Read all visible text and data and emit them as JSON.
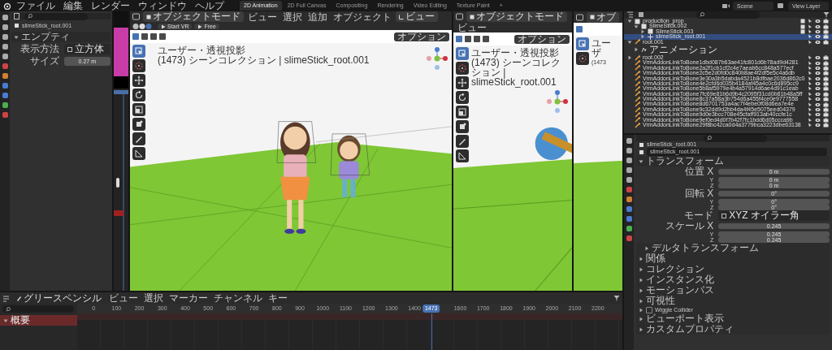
{
  "menu": [
    "ファイル",
    "編集",
    "レンダー",
    "ウィンドウ",
    "ヘルプ"
  ],
  "workspaces": [
    {
      "label": "2D Animation",
      "selected": true
    },
    {
      "label": "2D Full Canvas",
      "selected": false
    },
    {
      "label": "Compositing",
      "selected": false
    },
    {
      "label": "Rendering",
      "selected": false
    },
    {
      "label": "Video Editing",
      "selected": false
    },
    {
      "label": "Texture Paint",
      "selected": false
    }
  ],
  "workspace_add": "+",
  "scene": "Scene",
  "view_layer": "View Layer",
  "left_properties": {
    "object_name": "slimeStick_root.001",
    "section": {
      "label": "エンプティ",
      "expanded": true
    },
    "fields": [
      {
        "label": "表示方法",
        "value": "立方体",
        "kind": "dropdown"
      },
      {
        "label": "サイズ",
        "value": "0.27 m",
        "kind": "number"
      }
    ]
  },
  "viewports": [
    {
      "mode": "オブジェクトモード",
      "menus": [
        "ビュー",
        "選択",
        "追加",
        "オブジェクト"
      ],
      "view_menu": "ビュー",
      "buttons": [
        "Start VR",
        "Free"
      ],
      "options": "オプション",
      "view_name": "ユーザー・透視投影",
      "info": "(1473) シーンコレクション | slimeStick_root.001",
      "tools": [
        {
          "kind": "select",
          "selected": true
        },
        {
          "kind": "cursor",
          "selected": false
        },
        {
          "kind": "move",
          "selected": false
        },
        {
          "kind": "rotate",
          "selected": false
        },
        {
          "kind": "scale",
          "selected": false
        },
        {
          "kind": "transform",
          "selected": false
        },
        {
          "kind": "annotate",
          "selected": false
        },
        {
          "kind": "measure",
          "selected": false
        }
      ]
    },
    {
      "mode": "オブジェクトモード",
      "menus": [
        "ビュー"
      ],
      "options": "オプション",
      "view_name": "ユーザー・透視投影",
      "info": "(1473) シーンコレクション | slimeStick_root.001",
      "tools": [
        {
          "kind": "select",
          "selected": true
        },
        {
          "kind": "cursor",
          "selected": false
        },
        {
          "kind": "move",
          "selected": false
        },
        {
          "kind": "rotate",
          "selected": false
        },
        {
          "kind": "scale",
          "selected": false
        },
        {
          "kind": "transform",
          "selected": false
        },
        {
          "kind": "annotate",
          "selected": false
        },
        {
          "kind": "measure",
          "selected": false
        }
      ]
    },
    {
      "mode": "オブ",
      "view_name": "ユーザ",
      "info": "(1473",
      "tools": [
        {
          "kind": "select",
          "selected": true
        },
        {
          "kind": "cursor",
          "selected": false
        }
      ]
    }
  ],
  "outliner": {
    "items": [
      {
        "label": "production_prop",
        "kind": "collection",
        "expanded": true,
        "selected": false,
        "children": [
          {
            "label": "SlimeStick.002",
            "kind": "collection",
            "expanded": true,
            "selected": false,
            "children": [
              {
                "label": "SlimeStick.003",
                "kind": "collection",
                "expanded": false,
                "selected": false
              },
              {
                "label": "slimeStick_root.001",
                "kind": "empty",
                "expanded": false,
                "selected": true
              }
            ]
          }
        ]
      },
      {
        "label": "root.001",
        "kind": "armature",
        "expanded": true,
        "selected": false,
        "children": [
          {
            "label": "アニメーション",
            "kind": "action",
            "expanded": false,
            "selected": false
          }
        ]
      },
      {
        "label": "root.002",
        "kind": "armature",
        "expanded": false,
        "selected": false
      },
      {
        "label": "VrmAddonLinkToBone1dbd087b63ae41fc801d6b78ad9d4281",
        "kind": "bone",
        "selected": false
      },
      {
        "label": "VrmAddonLinkToBone2a2f1cb1cf2c4e7aeab6cc848a577ecf",
        "kind": "bone",
        "selected": false
      },
      {
        "label": "VrmAddonLinkToBone2c5e2d0fd0c840b8ae4f2df5e5c4a6db",
        "kind": "bone",
        "selected": false
      },
      {
        "label": "VrmAddonLinkToBone3e30a3b5dabda4521b8dfbae2036d862c0",
        "kind": "bone",
        "selected": false
      },
      {
        "label": "VrmAddonLinkToBone4e2cfd6d035b4184af45a4c0c6d895cc9",
        "kind": "bone",
        "selected": false
      },
      {
        "label": "VrmAddonLinkToBone5b8af5979e4b4a57914d6ae4d91c1eab",
        "kind": "bone",
        "selected": false
      },
      {
        "label": "VrmAddonLinkToBone7fc69e81b6d9b4c2095f31cd0b81b48a5ff",
        "kind": "bone",
        "selected": false
      },
      {
        "label": "VrmAddonLinkToBone8c37a58a3b754d6a455f4ce0e9777558",
        "kind": "bone",
        "selected": false
      },
      {
        "label": "VrmAddonLinkToBone8d6701753a4ac7f4ebe0f08d6ea7e4e",
        "kind": "bone",
        "selected": false
      },
      {
        "label": "VrmAddonLinkToBone9c32dd9d2bb4da4f45e5075eed04379",
        "kind": "bone",
        "selected": false
      },
      {
        "label": "VrmAddonLinkToBone9d0e3bcc708e45cfaff913ab40ccfe1c",
        "kind": "bone",
        "selected": false
      },
      {
        "label": "VrmAddonLinkToBone9ef0ed4d0f7b42f7fc1bdd6d05ccca9b",
        "kind": "bone",
        "selected": false
      },
      {
        "label": "VrmAddonLinkToBone29f8bc42ca0d4a3779bca3223dbe63138",
        "kind": "bone",
        "selected": false
      }
    ]
  },
  "properties": {
    "object_name": "slimeStick_root.001",
    "data_name": "slimeStick_root.001",
    "transform": {
      "label": "トランスフォーム",
      "expanded": true
    },
    "fields": [
      {
        "label": "位置 X",
        "value": "0 m",
        "kind": "number"
      },
      {
        "label": "Y",
        "value": "0 m",
        "kind": "number"
      },
      {
        "label": "Z",
        "value": "0 m",
        "kind": "number"
      },
      {
        "label": "回転 X",
        "value": "0°",
        "kind": "number"
      },
      {
        "label": "Y",
        "value": "0°",
        "kind": "number"
      },
      {
        "label": "Z",
        "value": "0°",
        "kind": "number"
      },
      {
        "label": "モード",
        "value": "XYZ オイラー角",
        "kind": "dropdown"
      },
      {
        "label": "スケール X",
        "value": "0.245",
        "kind": "number"
      },
      {
        "label": "Y",
        "value": "0.245",
        "kind": "number"
      },
      {
        "label": "Z",
        "value": "0.245",
        "kind": "number"
      }
    ],
    "delta": {
      "label": "デルタトランスフォーム",
      "expanded": false
    },
    "sections": [
      {
        "label": "関係",
        "expanded": false,
        "kind": "plain"
      },
      {
        "label": "コレクション",
        "expanded": false,
        "kind": "plain"
      },
      {
        "label": "インスタンス化",
        "expanded": false,
        "kind": "plain"
      },
      {
        "label": "モーションパス",
        "expanded": false,
        "kind": "plain"
      },
      {
        "label": "可視性",
        "expanded": false,
        "kind": "plain"
      },
      {
        "label": "Wiggle Collider",
        "expanded": false,
        "kind": "checkbox",
        "checked": false
      },
      {
        "label": "ビューポート表示",
        "expanded": false,
        "kind": "plain"
      },
      {
        "label": "カスタムプロパティ",
        "expanded": false,
        "kind": "plain"
      }
    ]
  },
  "dopesheet": {
    "mode": "グリースペンシル",
    "menus": [
      "ビュー",
      "選択",
      "マーカー",
      "チャンネル",
      "キー"
    ],
    "ticks": [
      "0",
      "100",
      "200",
      "300",
      "400",
      "500",
      "600",
      "700",
      "800",
      "900",
      "1000",
      "1100",
      "1200",
      "1300",
      "1400",
      "1600",
      "1700",
      "1800",
      "1900",
      "2000",
      "2100",
      "2200"
    ],
    "current_frame": "1473",
    "channels": [
      {
        "label": "概要",
        "expanded": true
      }
    ]
  }
}
